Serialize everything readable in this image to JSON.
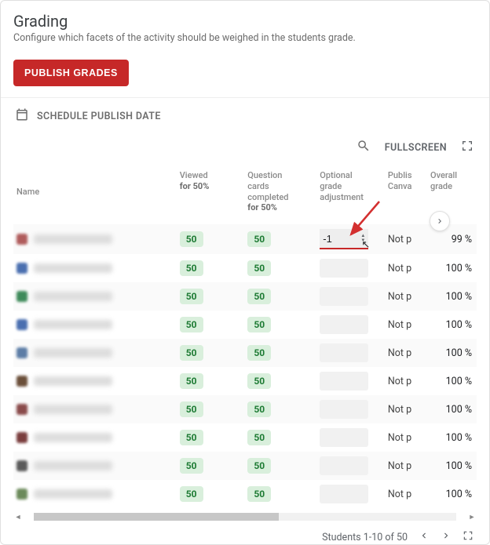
{
  "header": {
    "title": "Grading",
    "subtitle": "Configure which facets of the activity should be weighed in the students grade."
  },
  "actions": {
    "publish_label": "PUBLISH GRADES",
    "schedule_label": "SCHEDULE PUBLISH DATE",
    "fullscreen_label": "FULLSCREEN"
  },
  "table": {
    "columns": {
      "name": "Name",
      "viewed_l1": "Viewed",
      "viewed_l2": "for 50%",
      "qcc_l1": "Question",
      "qcc_l2": "cards",
      "qcc_l3": "completed",
      "qcc_l4": "for 50%",
      "adj_l1": "Optional",
      "adj_l2": "grade",
      "adj_l3": "adjustment",
      "pub_l1": "Publis",
      "pub_l2": "Canva",
      "og_l1": "Overall",
      "og_l2": "grade"
    },
    "rows": [
      {
        "avatar": "#b05c5c",
        "viewed": "50",
        "qcc": "50",
        "adj": "-1",
        "pub": "Not p",
        "og": "99 %",
        "active": true
      },
      {
        "avatar": "#4a6fb0",
        "viewed": "50",
        "qcc": "50",
        "adj": "",
        "pub": "Not p",
        "og": "100 %",
        "active": false
      },
      {
        "avatar": "#3e8a5a",
        "viewed": "50",
        "qcc": "50",
        "adj": "",
        "pub": "Not p",
        "og": "100 %",
        "active": false
      },
      {
        "avatar": "#4a6fb0",
        "viewed": "50",
        "qcc": "50",
        "adj": "",
        "pub": "Not p",
        "og": "100 %",
        "active": false
      },
      {
        "avatar": "#5c7da6",
        "viewed": "50",
        "qcc": "50",
        "adj": "",
        "pub": "Not p",
        "og": "100 %",
        "active": false
      },
      {
        "avatar": "#6b4f3a",
        "viewed": "50",
        "qcc": "50",
        "adj": "",
        "pub": "Not p",
        "og": "100 %",
        "active": false
      },
      {
        "avatar": "#8a4b4b",
        "viewed": "50",
        "qcc": "50",
        "adj": "",
        "pub": "Not p",
        "og": "100 %",
        "active": false
      },
      {
        "avatar": "#7a3d3d",
        "viewed": "50",
        "qcc": "50",
        "adj": "",
        "pub": "Not p",
        "og": "100 %",
        "active": false
      },
      {
        "avatar": "#5a5a5a",
        "viewed": "50",
        "qcc": "50",
        "adj": "",
        "pub": "Not p",
        "og": "100 %",
        "active": false
      },
      {
        "avatar": "#6b8a5a",
        "viewed": "50",
        "qcc": "50",
        "adj": "",
        "pub": "Not p",
        "og": "100 %",
        "active": false
      }
    ]
  },
  "footer": {
    "range": "Students 1-10 of 50"
  }
}
